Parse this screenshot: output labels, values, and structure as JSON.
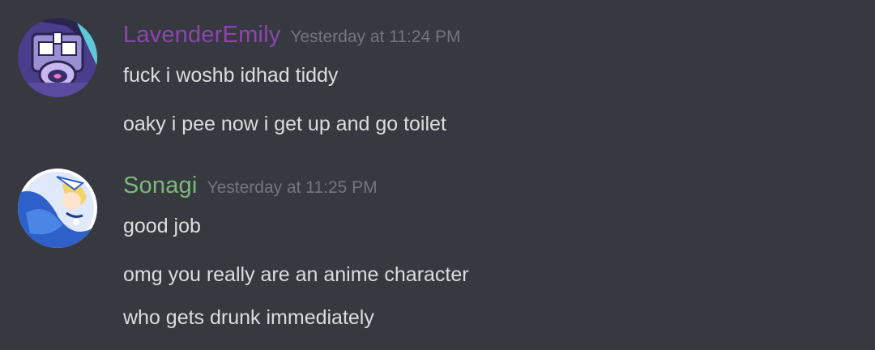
{
  "colors": {
    "background": "#36393f",
    "message_text": "#dcddde",
    "timestamp": "#72767d"
  },
  "messages": [
    {
      "username": "LavenderEmily",
      "username_color": "#8e44ad",
      "timestamp": "Yesterday at 11:24 PM",
      "avatar_icon": "purple-robot-avatar",
      "lines": [
        "fuck i woshb idhad tiddy",
        "oaky i pee now i get up and  go toilet"
      ]
    },
    {
      "username": "Sonagi",
      "username_color": "#7fb97a",
      "timestamp": "Yesterday at 11:25 PM",
      "avatar_icon": "blue-anime-character-avatar",
      "lines": [
        "good job",
        "omg you really are an anime character",
        "who gets drunk immediately"
      ]
    }
  ]
}
